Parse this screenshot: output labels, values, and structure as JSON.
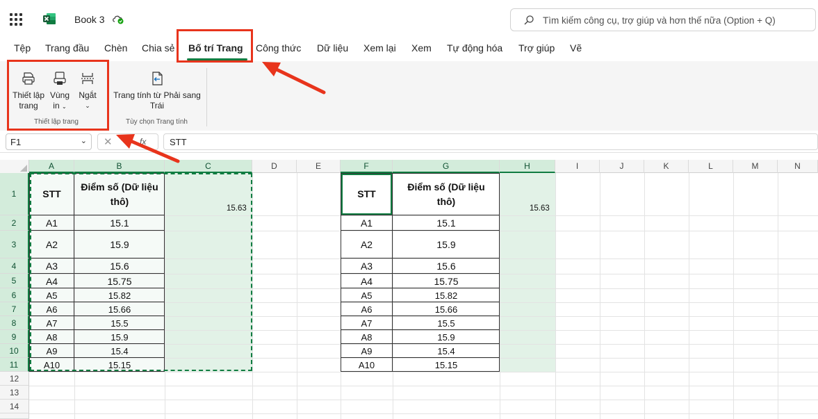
{
  "app": {
    "title": "Book 3"
  },
  "search": {
    "placeholder": "Tìm kiếm công cụ, trợ giúp và hơn thế nữa (Option + Q)"
  },
  "menu": {
    "items": [
      {
        "label": "Tệp"
      },
      {
        "label": "Trang đầu"
      },
      {
        "label": "Chèn"
      },
      {
        "label": "Chia sẻ"
      },
      {
        "label": "Bố trí Trang",
        "active": true
      },
      {
        "label": "Công thức"
      },
      {
        "label": "Dữ liệu"
      },
      {
        "label": "Xem lại"
      },
      {
        "label": "Xem"
      },
      {
        "label": "Tự động hóa"
      },
      {
        "label": "Trợ giúp"
      },
      {
        "label": "Vẽ"
      }
    ]
  },
  "ribbon": {
    "page_setup": {
      "label": "Thiết lập trang",
      "setup_l1": "Thiết lập",
      "setup_l2": "trang",
      "area_l1": "Vùng",
      "area_l2": "in",
      "breaks_label": "Ngắt"
    },
    "sheet_options": {
      "label": "Tùy chọn Trang tính",
      "rtl_l1": "Trang tính từ Phải sang",
      "rtl_l2": "Trái"
    }
  },
  "formula_bar": {
    "name_box": "F1",
    "fx": "fx",
    "value": "STT"
  },
  "columns": [
    "A",
    "B",
    "C",
    "D",
    "E",
    "F",
    "G",
    "H",
    "I",
    "J",
    "K",
    "L",
    "M",
    "N"
  ],
  "rows": [
    "1",
    "2",
    "3",
    "4",
    "5",
    "6",
    "7",
    "8",
    "9",
    "10",
    "11",
    "12",
    "13",
    "14"
  ],
  "table": {
    "header_stt": "STT",
    "header_score_l1": "Điểm số (Dữ liệu",
    "header_score_l2": "thô)",
    "rows": [
      {
        "stt": "A1",
        "score": "15.1"
      },
      {
        "stt": "A2",
        "score": "15.9"
      },
      {
        "stt": "A3",
        "score": "15.6"
      },
      {
        "stt": "A4",
        "score": "15.75"
      },
      {
        "stt": "A5",
        "score": "15.82"
      },
      {
        "stt": "A6",
        "score": "15.66"
      },
      {
        "stt": "A7",
        "score": "15.5"
      },
      {
        "stt": "A8",
        "score": "15.9"
      },
      {
        "stt": "A9",
        "score": "15.4"
      },
      {
        "stt": "A10",
        "score": "15.15"
      }
    ],
    "side_value": "15.63"
  },
  "colors": {
    "accent": "#107c41",
    "highlight": "#e8341c",
    "selection": "#e2f2e7"
  }
}
